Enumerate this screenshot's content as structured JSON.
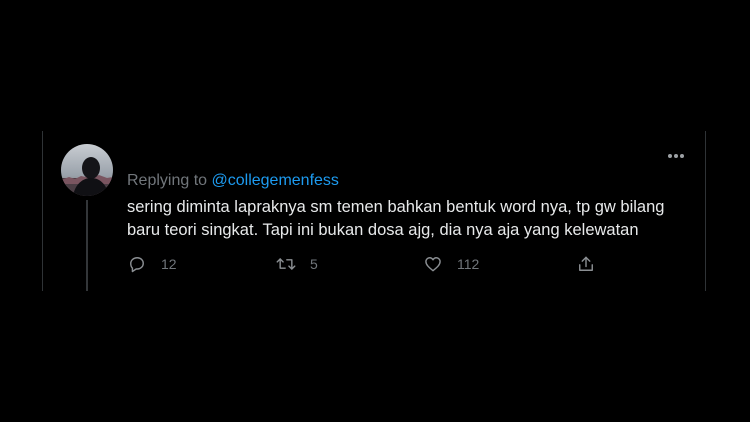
{
  "reply": {
    "prefix": "Replying to",
    "handle": "@collegemenfess"
  },
  "tweet": {
    "text_line1": "sering diminta lapraknya sm temen bahkan bentuk word nya, tp gw bilang",
    "text_line2": "baru teori singkat. Tapi ini bukan dosa ajg, dia nya aja yang kelewatan"
  },
  "actions": {
    "reply_count": "12",
    "retweet_count": "5",
    "like_count": "112"
  },
  "icons": {
    "more": "more-horizontal-icon",
    "reply": "comment-bubble-icon",
    "retweet": "retweet-icon",
    "like": "heart-icon",
    "share": "share-upload-icon"
  },
  "colors": {
    "background": "#000000",
    "text": "#e7e9ea",
    "muted": "#71767b",
    "accent": "#1d9bf0",
    "border": "#2f3336"
  }
}
